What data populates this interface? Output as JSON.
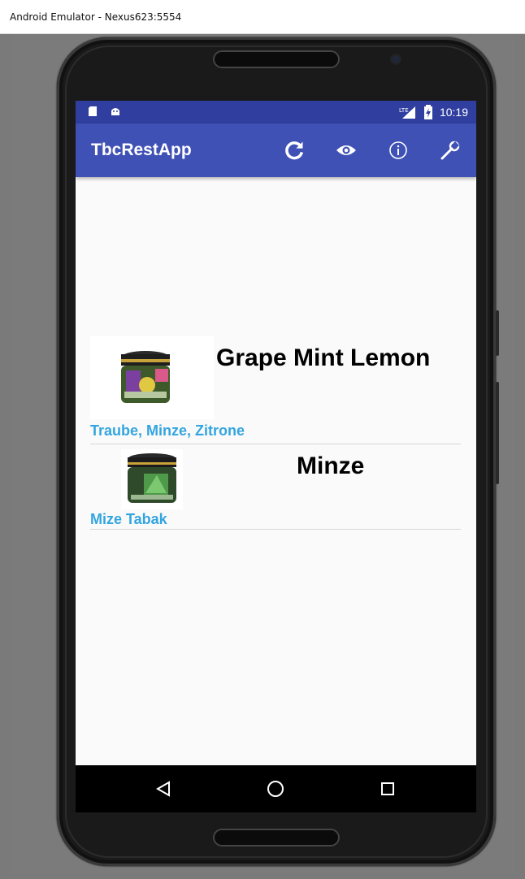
{
  "window": {
    "title": "Android Emulator - Nexus623:5554"
  },
  "status_bar": {
    "time": "10:19",
    "network_badge": "LTE",
    "icons": [
      "sd-card-icon",
      "android-icon",
      "signal-icon",
      "battery-charging-icon"
    ]
  },
  "app_bar": {
    "title": "TbcRestApp",
    "actions": [
      "refresh-icon",
      "eye-icon",
      "info-icon",
      "wrench-icon"
    ]
  },
  "list": {
    "items": [
      {
        "name": "Grape Mint Lemon",
        "description": "Traube, Minze, Zitrone",
        "image": "tobacco-jar-grape-mint-lemon"
      },
      {
        "name": "Minze",
        "description": "Mize Tabak",
        "image": "tobacco-jar-mint"
      }
    ]
  },
  "nav_bar": {
    "buttons": [
      "back-icon",
      "home-icon",
      "recents-icon"
    ]
  },
  "colors": {
    "status_bar": "#303f9f",
    "app_bar": "#3f51b5",
    "accent_text": "#33a5e0",
    "screen_bg": "#fafafa"
  }
}
